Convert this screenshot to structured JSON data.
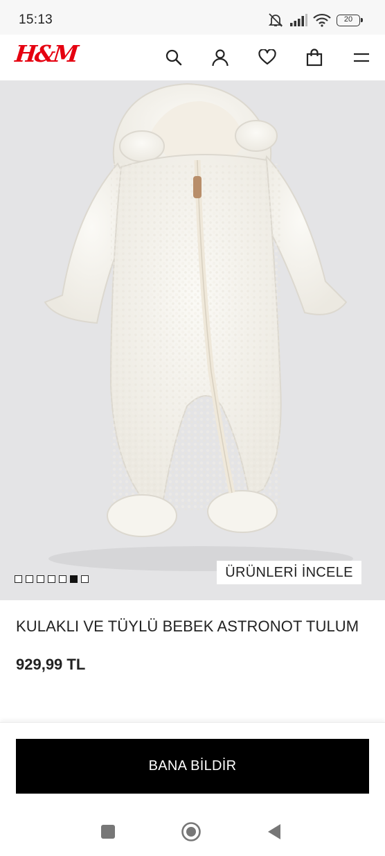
{
  "status_bar": {
    "time": "15:13",
    "battery": "20",
    "icons": [
      "mute-icon",
      "signal-icon",
      "wifi-icon",
      "battery-icon"
    ]
  },
  "header": {
    "logo": "H&M",
    "brand_color": "#e50010",
    "icons": [
      "search-icon",
      "account-icon",
      "favorites-icon",
      "shopping-bag-icon",
      "menu-icon"
    ]
  },
  "gallery": {
    "total_images": 7,
    "active_index": 5,
    "inspect_label": "ÜRÜNLERİ İNCELE",
    "background": "#e4e4e6"
  },
  "product": {
    "title": "KULAKLI VE TÜYLÜ BEBEK ASTRONOT TULUM",
    "price": "929,99 TL"
  },
  "actions": {
    "notify_label": "BANA BİLDİR"
  },
  "system_nav": {
    "buttons": [
      "recents-icon",
      "home-icon",
      "back-icon"
    ]
  }
}
